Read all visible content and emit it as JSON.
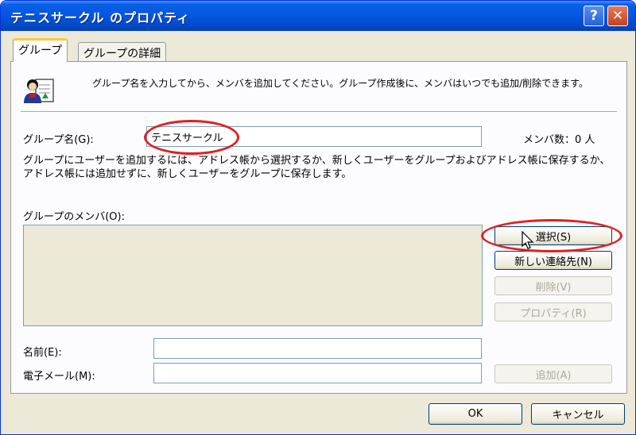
{
  "window": {
    "title": "テニスサークル のプロパティ",
    "help": "?",
    "close": "✕"
  },
  "tabs": {
    "group": "グループ",
    "group_details": "グループの詳細"
  },
  "intro_text": "グループ名を入力してから、メンバを追加してください。グループ作成後に、メンバはいつでも追加/削除できます。",
  "group_name": {
    "label": "グループ名(G):",
    "value": "テニスサークル",
    "member_count": "メンバ数：0 人"
  },
  "description": "グループにユーザーを追加するには、アドレス帳から選択するか、新しくユーザーをグループおよびアドレス帳に保存するか、アドレス帳には追加せずに、新しくユーザーをグループに保存します。",
  "members": {
    "label": "グループのメンバ(O):"
  },
  "buttons": {
    "select": "選択(S)",
    "new_contact": "新しい連絡先(N)",
    "delete": "削除(V)",
    "properties": "プロパティ(R)",
    "add": "追加(A)",
    "ok": "OK",
    "cancel": "キャンセル"
  },
  "fields": {
    "name_label": "名前(E):",
    "email_label": "電子メール(M):"
  },
  "annotation_color": "#e02020"
}
